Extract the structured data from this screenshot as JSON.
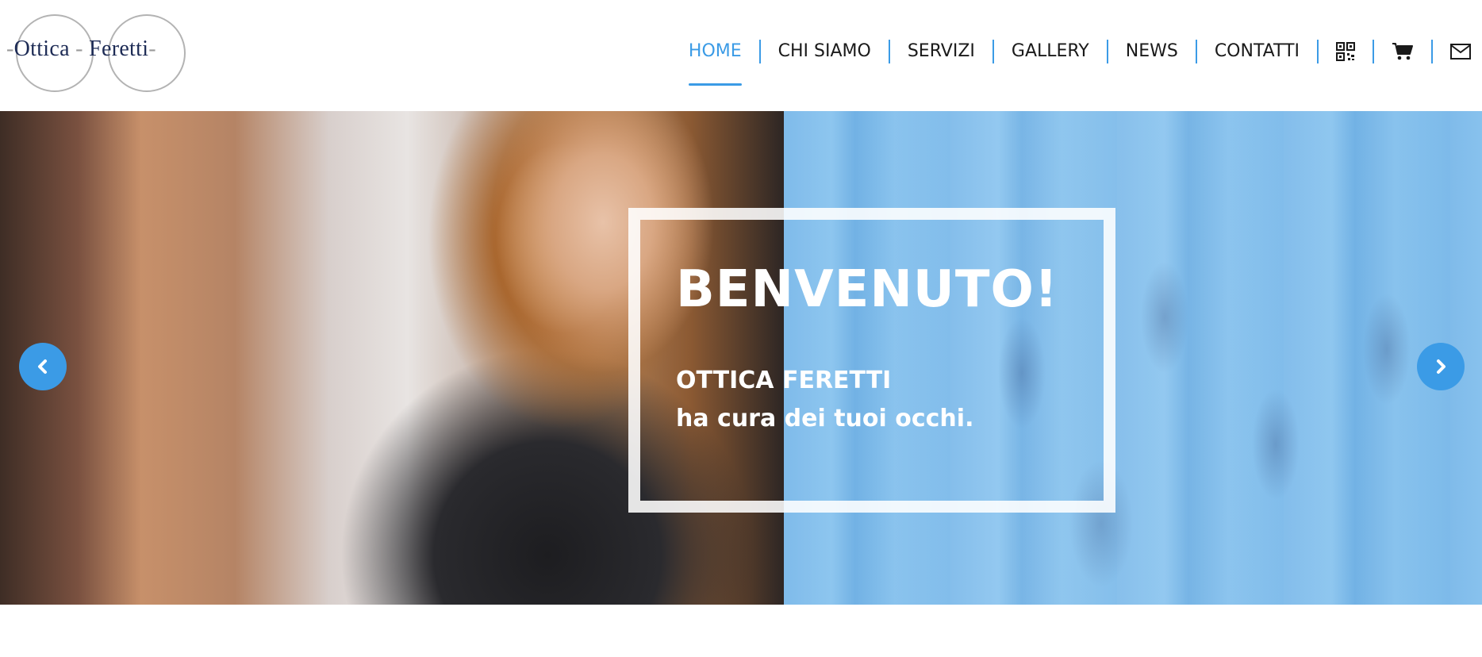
{
  "logo": {
    "word1": "Ottica",
    "word2": "Feretti",
    "dash": "-"
  },
  "nav": {
    "items": [
      {
        "label": "HOME",
        "active": true
      },
      {
        "label": "CHI SIAMO",
        "active": false
      },
      {
        "label": "SERVIZI",
        "active": false
      },
      {
        "label": "GALLERY",
        "active": false
      },
      {
        "label": "NEWS",
        "active": false
      },
      {
        "label": "CONTATTI",
        "active": false
      }
    ],
    "icons": [
      "qr-code-icon",
      "cart-icon",
      "mail-icon"
    ]
  },
  "hero": {
    "title": "BENVENUTO!",
    "subtitle_line1": "OTTICA FERETTI",
    "subtitle_line2": "ha cura dei tuoi occhi.",
    "prev_icon": "chevron-left-icon",
    "next_icon": "chevron-right-icon"
  },
  "colors": {
    "accent": "#3b9be6",
    "logo_text": "#1d2b55",
    "nav_text": "#1a1a1a"
  }
}
